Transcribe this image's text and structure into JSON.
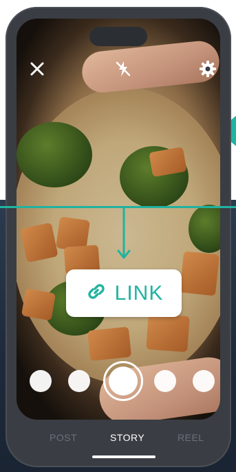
{
  "camera": {
    "modes": [
      "POST",
      "STORY",
      "REEL"
    ],
    "active_mode": "STORY"
  },
  "sticker": {
    "label": "LINK",
    "icon": "link-icon"
  },
  "top_controls": {
    "close_icon": "close-icon",
    "flash_icon": "flash-off-icon",
    "settings_icon": "gear-icon"
  },
  "colors": {
    "accent": "#1fb3a0",
    "phone_frame": "#3a3d43",
    "backdrop": "#1e2a3b"
  }
}
